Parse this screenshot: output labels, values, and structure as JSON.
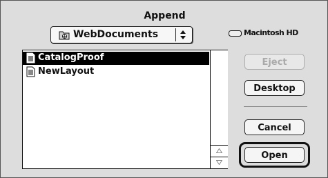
{
  "dialog": {
    "title": "Append"
  },
  "folder_popup": {
    "label": "WebDocuments",
    "icon": "folder-icon"
  },
  "volume": {
    "label": "Macintosh HD",
    "icon": "hard-disk-icon"
  },
  "file_list": {
    "items": [
      {
        "label": "CatalogProof",
        "selected": true,
        "icon": "document-icon"
      },
      {
        "label": "NewLayout",
        "selected": false,
        "icon": "document-icon"
      }
    ]
  },
  "buttons": {
    "eject": {
      "label": "Eject",
      "enabled": false
    },
    "desktop": {
      "label": "Desktop"
    },
    "cancel": {
      "label": "Cancel"
    },
    "open": {
      "label": "Open",
      "default": true
    }
  }
}
